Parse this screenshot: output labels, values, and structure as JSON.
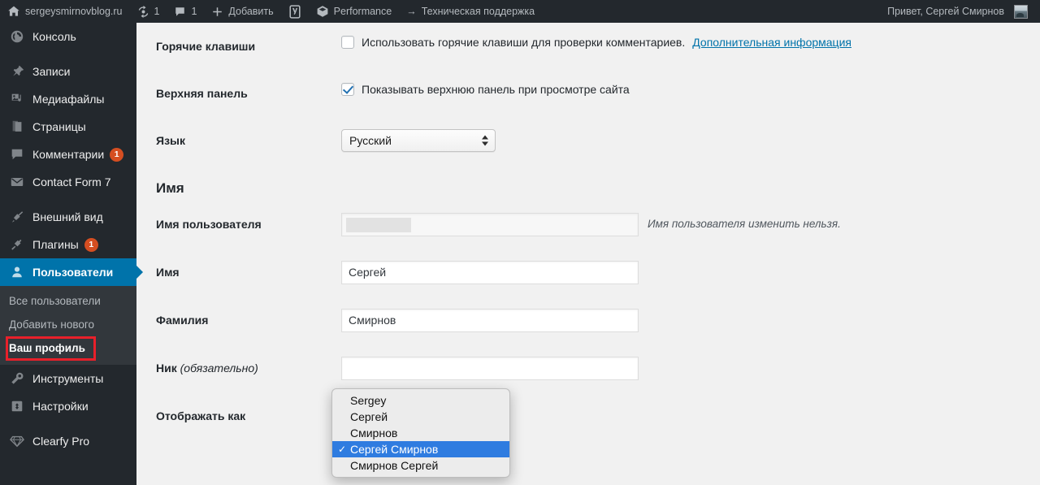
{
  "adminbar": {
    "site_name": "sergeysmirnovblog.ru",
    "home_icon": "wordpress-home-icon",
    "updates_icon": "updates-icon",
    "updates_count": "1",
    "comments_icon": "comment-bubble-icon",
    "comments_count": "1",
    "new_icon": "plus-icon",
    "new_label": "Добавить",
    "yoast_icon": "yoast-seo-icon",
    "performance_icon": "performance-cube-icon",
    "performance_label": "Performance",
    "support_arrow": "→",
    "support_label": "Техническая поддержка",
    "greeting": "Привет, Сергей Смирнов",
    "avatar_icon": "user-avatar"
  },
  "sidebar": {
    "items": [
      {
        "label": "Консоль",
        "icon": "dashboard-icon",
        "badge": "",
        "current": false
      },
      {
        "label": "Записи",
        "icon": "pin-icon",
        "badge": "",
        "current": false
      },
      {
        "label": "Медиафайлы",
        "icon": "media-icon",
        "badge": "",
        "current": false
      },
      {
        "label": "Страницы",
        "icon": "pages-icon",
        "badge": "",
        "current": false
      },
      {
        "label": "Комментарии",
        "icon": "comment-icon",
        "badge": "1",
        "current": false
      },
      {
        "label": "Contact Form 7",
        "icon": "envelope-icon",
        "badge": "",
        "current": false
      },
      {
        "label": "Внешний вид",
        "icon": "appearance-icon",
        "badge": "",
        "current": false
      },
      {
        "label": "Плагины",
        "icon": "plugin-icon",
        "badge": "1",
        "current": false
      },
      {
        "label": "Пользователи",
        "icon": "users-icon",
        "badge": "",
        "current": true
      }
    ],
    "submenu": [
      {
        "label": "Все пользователи",
        "current": false
      },
      {
        "label": "Добавить нового",
        "current": false
      },
      {
        "label": "Ваш профиль",
        "current": true
      }
    ],
    "items_after": [
      {
        "label": "Инструменты",
        "icon": "tools-icon",
        "badge": "",
        "current": false
      },
      {
        "label": "Настройки",
        "icon": "settings-icon",
        "badge": "",
        "current": false
      },
      {
        "label": "Clearfy Pro",
        "icon": "diamond-icon",
        "badge": "",
        "current": false
      }
    ],
    "highlight_color": "#e8202a",
    "current_color": "#0073aa"
  },
  "form": {
    "hotkeys": {
      "label": "Горячие клавиши",
      "checkbox_checked": false,
      "text": "Использовать горячие клавиши для проверки комментариев.",
      "link": "Дополнительная информация"
    },
    "toolbar": {
      "label": "Верхняя панель",
      "checkbox_checked": true,
      "text": "Показывать верхнюю панель при просмотре сайта"
    },
    "language": {
      "label": "Язык",
      "value": "Русский"
    },
    "section_name": "Имя",
    "username": {
      "label": "Имя пользователя",
      "value": "",
      "description": "Имя пользователя изменить нельзя."
    },
    "first_name": {
      "label": "Имя",
      "value": "Сергей"
    },
    "last_name": {
      "label": "Фамилия",
      "value": "Смирнов"
    },
    "nickname": {
      "label": "Ник",
      "label_note": "(обязательно)",
      "value": ""
    },
    "display_name": {
      "label": "Отображать как",
      "value": "Сергей Смирнов",
      "options": [
        {
          "label": "Sergey",
          "selected": false
        },
        {
          "label": "Сергей",
          "selected": false
        },
        {
          "label": "Смирнов",
          "selected": false
        },
        {
          "label": "Сергей Смирнов",
          "selected": true
        },
        {
          "label": "Смирнов Сергей",
          "selected": false
        }
      ]
    }
  }
}
